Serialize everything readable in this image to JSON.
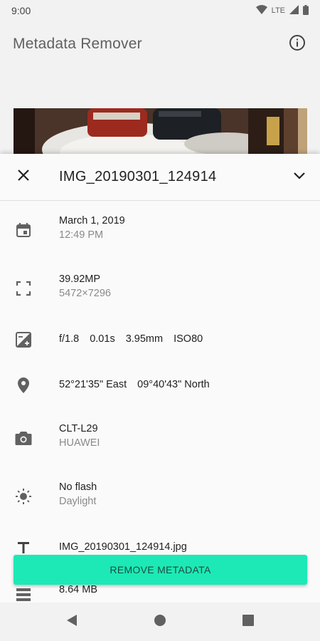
{
  "status_bar": {
    "time": "9:00",
    "network": "LTE"
  },
  "app_bar": {
    "title": "Metadata Remover"
  },
  "sheet": {
    "title": "IMG_20190301_124914",
    "date": {
      "primary": "March 1, 2019",
      "secondary": "12:49 PM"
    },
    "resolution": {
      "primary": "39.92MP",
      "secondary": "5472×7296"
    },
    "exposure": {
      "aperture": "f/1.8",
      "shutter": "0.01s",
      "focal": "3.95mm",
      "iso": "ISO80"
    },
    "location": {
      "longitude": "52°21'35\" East",
      "latitude": "09°40'43\" North"
    },
    "camera": {
      "primary": "CLT-L29",
      "secondary": "HUAWEI"
    },
    "flash": {
      "primary": "No flash",
      "secondary": "Daylight"
    },
    "filename": {
      "primary": "IMG_20190301_124914.jpg"
    },
    "filesize": {
      "primary": "8.64 MB"
    }
  },
  "actions": {
    "remove_label": "REMOVE METADATA"
  },
  "icons": {
    "info": "info-icon",
    "close": "close-icon",
    "collapse": "chevron-down-icon",
    "date": "calendar-icon",
    "resolution": "fullscreen-icon",
    "exposure": "exposure-icon",
    "location": "location-pin-icon",
    "camera": "camera-icon",
    "flash": "brightness-icon",
    "filename": "text-icon",
    "filesize": "storage-icon"
  },
  "colors": {
    "accent": "#1de9b6",
    "background": "#fafafa",
    "icon": "#616161"
  }
}
